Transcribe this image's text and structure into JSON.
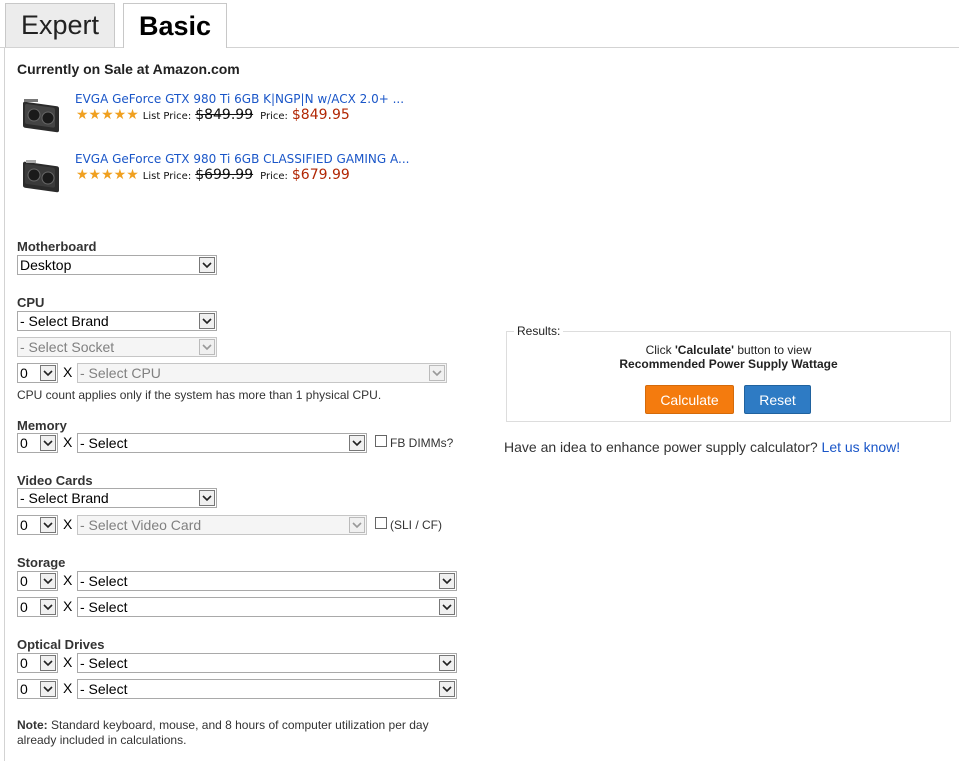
{
  "tabs": [
    {
      "label": "Expert"
    },
    {
      "label": "Basic"
    }
  ],
  "sale": {
    "heading": "Currently on Sale at Amazon.com",
    "items": [
      {
        "title": "EVGA GeForce GTX 980 Ti 6GB K|NGP|N w/ACX 2.0+ ...",
        "stars": "★★★★★",
        "list_label": "List Price:",
        "list_price": "$849.99",
        "price_label": "Price:",
        "price": "$849.95"
      },
      {
        "title": "EVGA GeForce GTX 980 Ti 6GB CLASSIFIED GAMING A...",
        "stars": "★★★★★",
        "list_label": "List Price:",
        "list_price": "$699.99",
        "price_label": "Price:",
        "price": "$679.99"
      }
    ]
  },
  "motherboard": {
    "label": "Motherboard",
    "value": "Desktop"
  },
  "cpu": {
    "label": "CPU",
    "brand": "- Select Brand",
    "socket": "- Select Socket",
    "count": "0",
    "x": "X",
    "cpu": "- Select CPU",
    "note": "CPU count applies only if the system has more than 1 physical CPU."
  },
  "memory": {
    "label": "Memory",
    "count": "0",
    "x": "X",
    "value": "- Select",
    "fb_label": "FB DIMMs?"
  },
  "video": {
    "label": "Video Cards",
    "brand": "- Select Brand",
    "count": "0",
    "x": "X",
    "card": "- Select Video Card",
    "sli_label": "(SLI / CF)"
  },
  "storage": {
    "label": "Storage",
    "rows": [
      {
        "count": "0",
        "x": "X",
        "value": "- Select"
      },
      {
        "count": "0",
        "x": "X",
        "value": "- Select"
      }
    ]
  },
  "optical": {
    "label": "Optical Drives",
    "rows": [
      {
        "count": "0",
        "x": "X",
        "value": "- Select"
      },
      {
        "count": "0",
        "x": "X",
        "value": "- Select"
      }
    ]
  },
  "footnote": {
    "bold": "Note:",
    "text": "Standard keyboard, mouse, and 8 hours of computer utilization per day already included in calculations."
  },
  "results": {
    "legend": "Results:",
    "line1_pre": "Click ",
    "line1_bold": "'Calculate'",
    "line1_post": " button to view",
    "line2": "Recommended Power Supply Wattage",
    "calculate": "Calculate",
    "reset": "Reset"
  },
  "idea": {
    "text": "Have an idea to enhance power supply calculator? ",
    "link": "Let us know!"
  },
  "colors": {
    "calculate": "#f47b0e",
    "reset": "#2e7bc4",
    "link": "#1a56c8",
    "price": "#b12704",
    "stars": "#f0a020"
  }
}
